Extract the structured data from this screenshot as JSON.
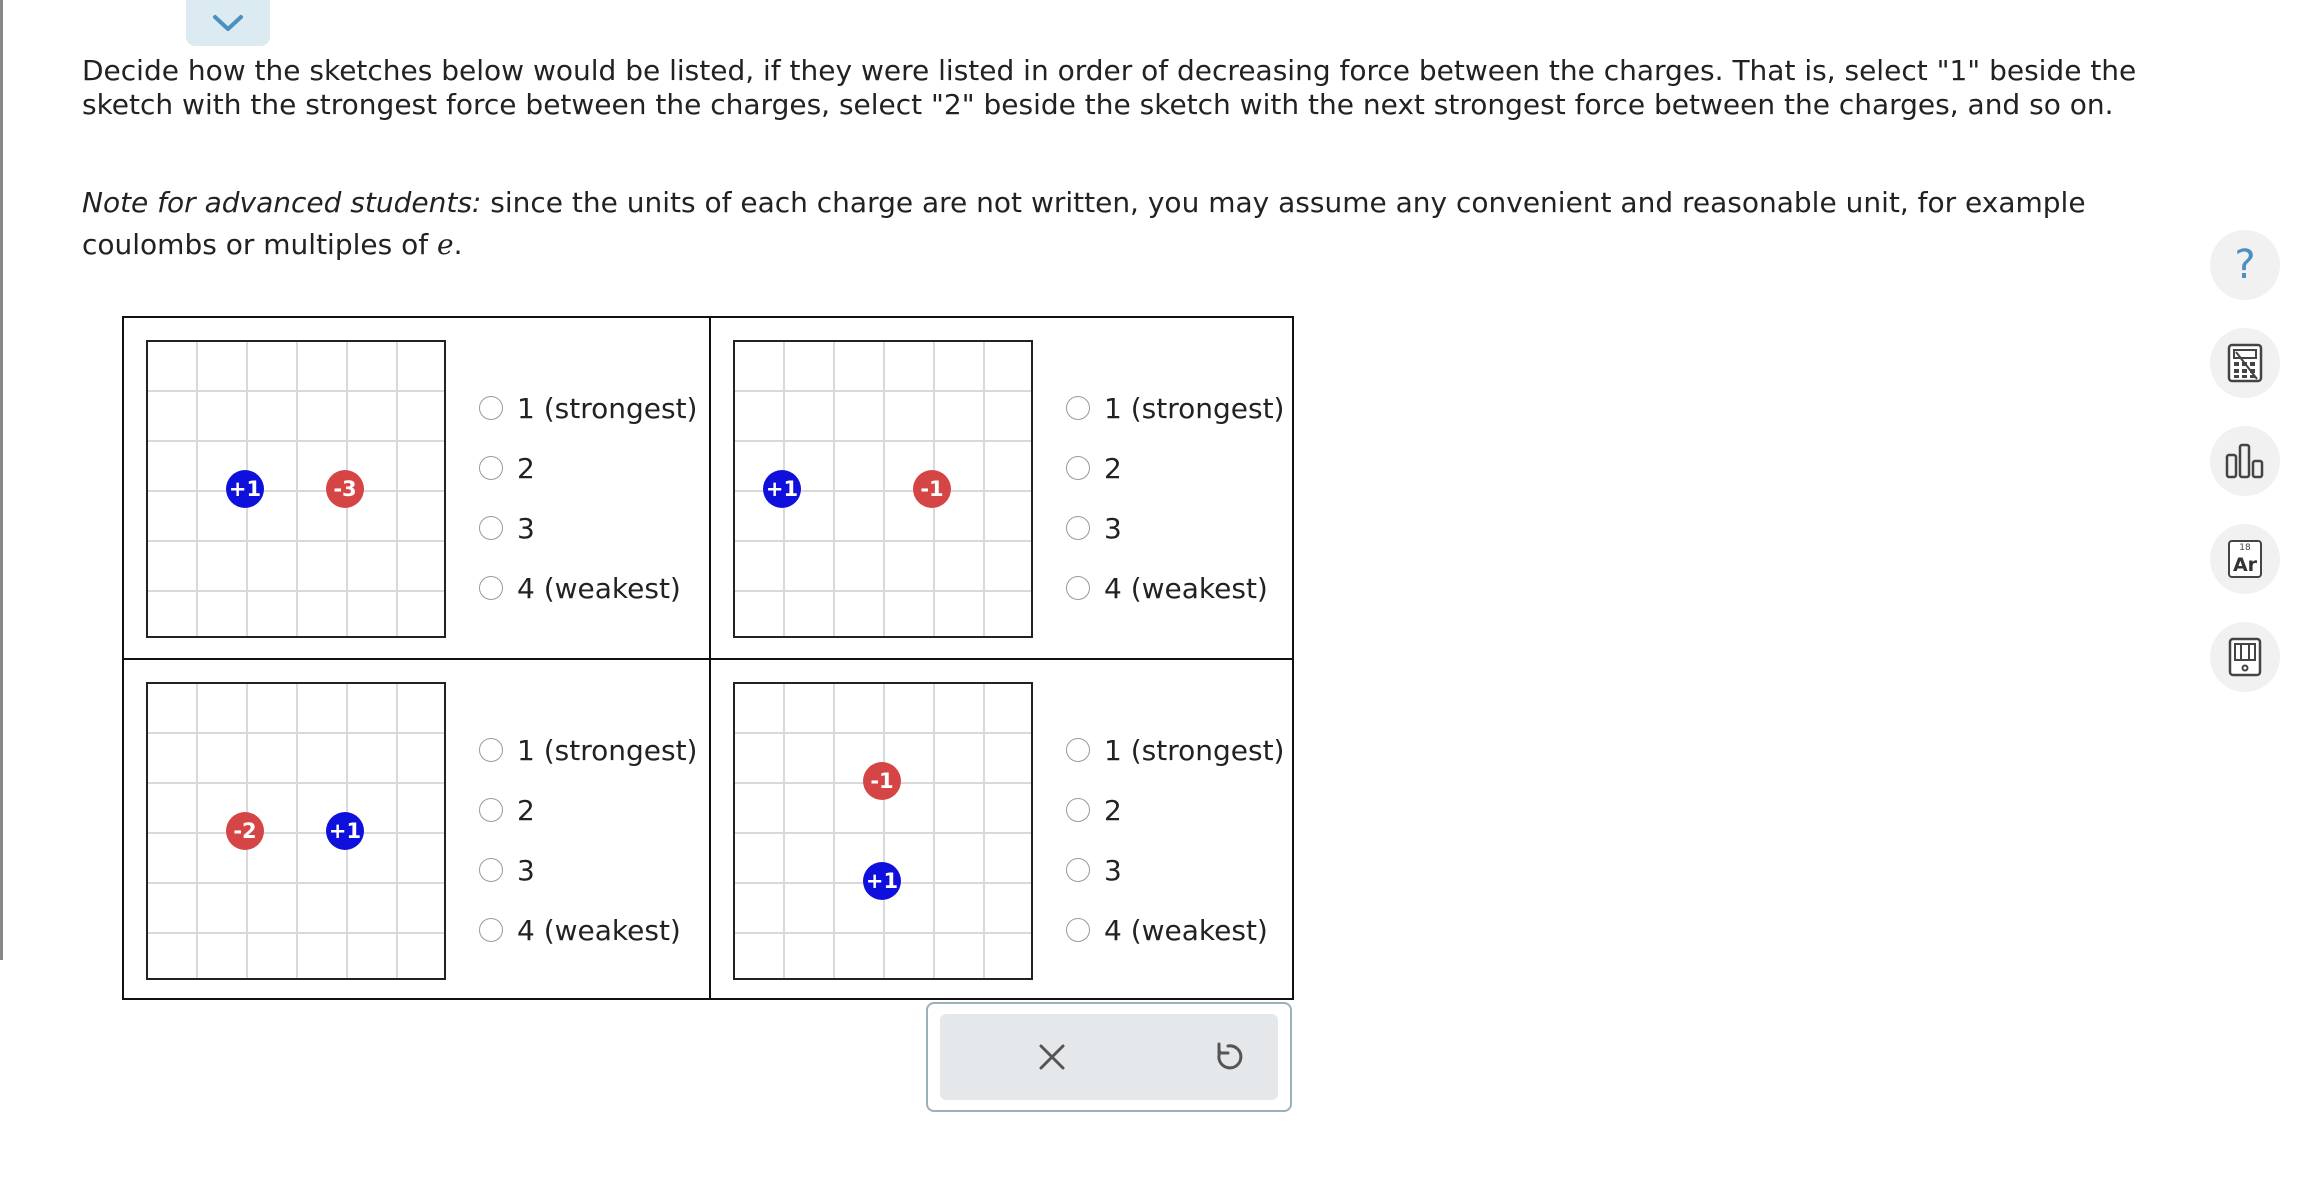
{
  "instructions": {
    "main": "Decide how the sketches below would be listed, if they were listed in order of decreasing force between the charges. That is, select \"1\" beside the sketch with the strongest force between the charges, select \"2\" beside the sketch with the next strongest force between the charges, and so on.",
    "note_prefix": "Note for advanced students:",
    "note_body": " since the units of each charge are not written, you may assume any convenient and reasonable unit, for example coulombs or multiples of ",
    "note_var": "e",
    "note_end": "."
  },
  "options": [
    "1 (strongest)",
    "2",
    "3",
    "4 (weakest)"
  ],
  "sketches": [
    {
      "charges": [
        {
          "label": "+1",
          "sign": "positive"
        },
        {
          "label": "-3",
          "sign": "negative"
        }
      ]
    },
    {
      "charges": [
        {
          "label": "+1",
          "sign": "positive"
        },
        {
          "label": "-1",
          "sign": "negative"
        }
      ]
    },
    {
      "charges": [
        {
          "label": "-2",
          "sign": "negative"
        },
        {
          "label": "+1",
          "sign": "positive"
        }
      ]
    },
    {
      "charges": [
        {
          "label": "-1",
          "sign": "negative"
        },
        {
          "label": "+1",
          "sign": "positive"
        }
      ]
    }
  ],
  "colors": {
    "positive_charge": "#1010dc",
    "negative_charge": "#d64545",
    "accent": "#4a90c2",
    "action_panel": "#e4e8ea"
  },
  "icons": {
    "collapse": "chevron-down-icon",
    "clear": "close-icon",
    "undo": "undo-icon",
    "help": "help-icon",
    "calculator": "calculator-icon",
    "chart": "bar-chart-icon",
    "periodic_table": "periodic-table-icon",
    "reference": "reference-book-icon"
  },
  "toolbar": {
    "help_glyph": "?",
    "periodic_number": "18",
    "periodic_symbol": "Ar"
  }
}
